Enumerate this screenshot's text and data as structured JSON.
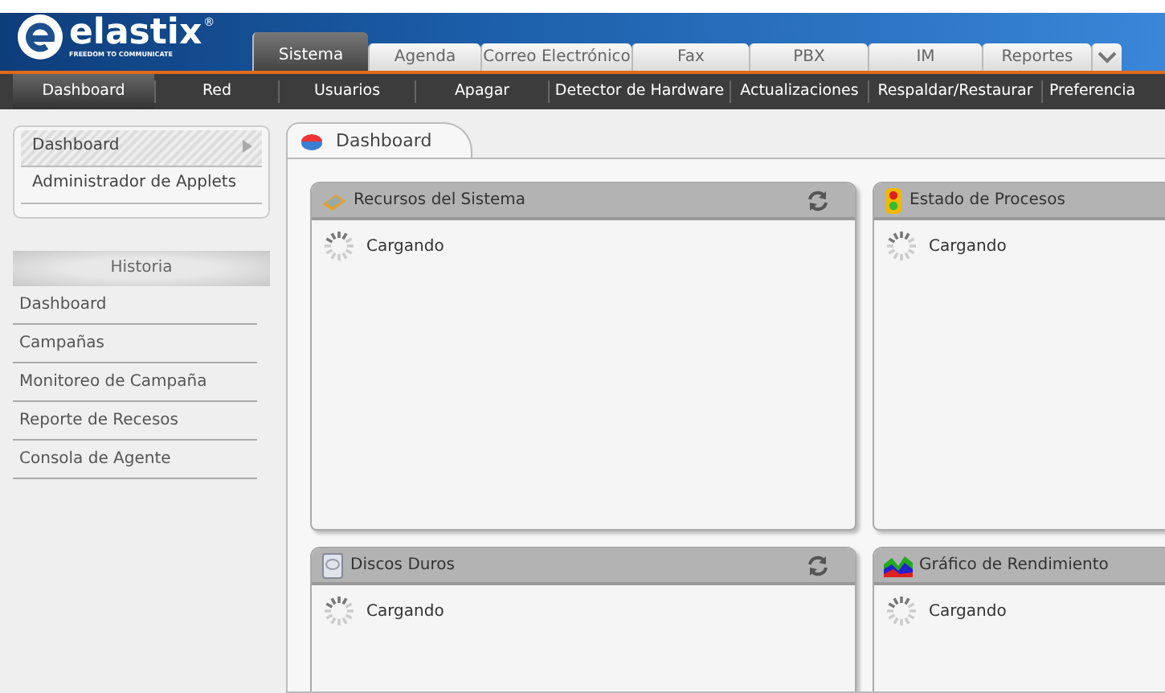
{
  "logo": {
    "name": "elastix",
    "registered": "®",
    "tagline": "FREEDOM TO COMMUNICATE"
  },
  "tabs": [
    {
      "label": "Sistema",
      "selected": true
    },
    {
      "label": "Agenda",
      "selected": false
    },
    {
      "label": "Correo Electrónico",
      "selected": false
    },
    {
      "label": "Fax",
      "selected": false
    },
    {
      "label": "PBX",
      "selected": false
    },
    {
      "label": "IM",
      "selected": false
    },
    {
      "label": "Reportes",
      "selected": false
    }
  ],
  "menu": [
    {
      "label": "Dashboard",
      "selected": true
    },
    {
      "label": "Red",
      "selected": false
    },
    {
      "label": "Usuarios",
      "selected": false
    },
    {
      "label": "Apagar",
      "selected": false
    },
    {
      "label": "Detector de Hardware",
      "selected": false
    },
    {
      "label": "Actualizaciones",
      "selected": false
    },
    {
      "label": "Respaldar/Restaurar",
      "selected": false
    },
    {
      "label": "Preferencia",
      "selected": false
    }
  ],
  "sidebar": {
    "items": [
      {
        "label": "Dashboard",
        "selected": true
      },
      {
        "label": "Administrador de Applets",
        "selected": false
      }
    ],
    "history_title": "Historia",
    "history": [
      "Dashboard",
      "Campañas",
      "Monitoreo de Campaña",
      "Reporte de Recesos",
      "Consola de Agente"
    ]
  },
  "page_tab": "Dashboard",
  "panels": [
    {
      "kind": "resources",
      "title": "Recursos del Sistema",
      "refreshable": true,
      "status": "Cargando"
    },
    {
      "kind": "processes",
      "title": "Estado de Procesos",
      "status": "Cargando"
    },
    {
      "kind": "disks",
      "title": "Discos Duros",
      "refreshable": true,
      "status": "Cargando"
    },
    {
      "kind": "performance",
      "title": "Gráfico de Rendimiento",
      "status": "Cargando"
    }
  ]
}
